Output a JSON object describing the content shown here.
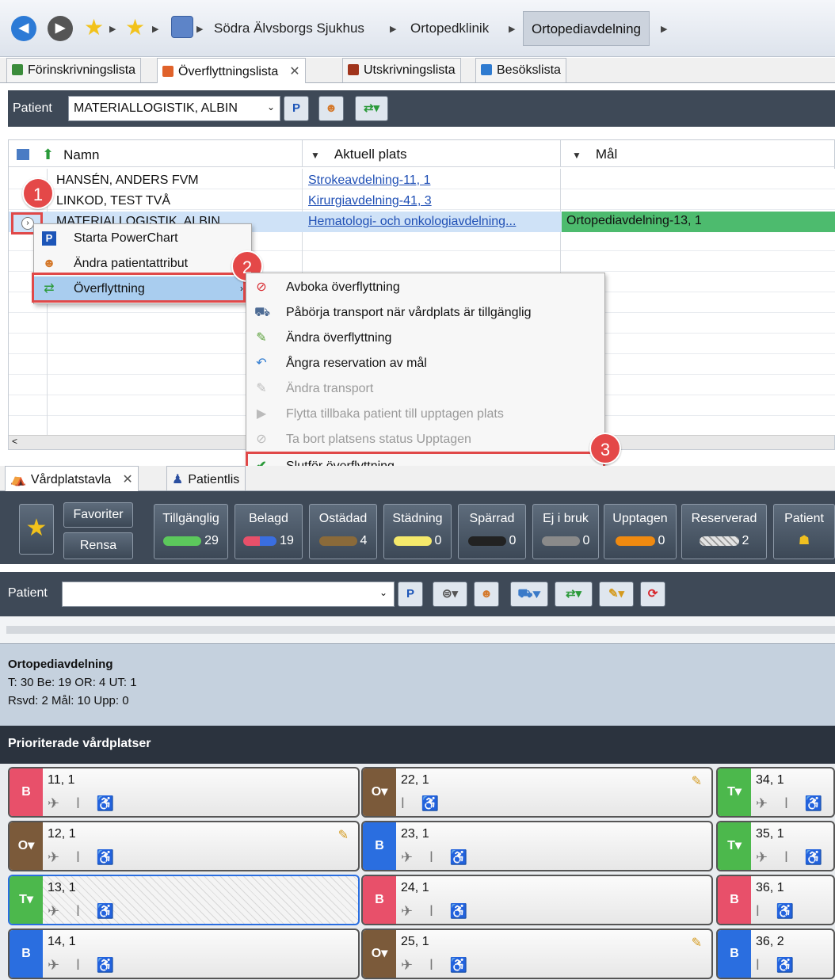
{
  "breadcrumb": {
    "items": [
      "Södra Älvsborgs Sjukhus",
      "Ortopedklinik",
      "Ortopediavdelning"
    ]
  },
  "top_tabs": [
    {
      "label": "Förinskrivningslista"
    },
    {
      "label": "Överflyttningslista"
    },
    {
      "label": "Utskrivningslista"
    },
    {
      "label": "Besökslista"
    }
  ],
  "patient_bar": {
    "label": "Patient",
    "selected": "MATERIALLOGISTIK, ALBIN",
    "p_button": "P"
  },
  "grid": {
    "columns": [
      "Namn",
      "Aktuell plats",
      "Mål"
    ],
    "rows": [
      {
        "name": "HANSÉN, ANDERS FVM",
        "place": "Strokeavdelning-11, 1",
        "goal": ""
      },
      {
        "name": "LINKOD, TEST TVÅ",
        "place": "Kirurgiavdelning-41, 3",
        "goal": ""
      },
      {
        "name": "MATERIALLOGISTIK, ALBIN",
        "place": "Hematologi- och onkologiavdelning...",
        "goal": "Ortopediavdelning-13, 1"
      }
    ]
  },
  "context_menu": [
    {
      "label": "Starta PowerChart",
      "icon": "p-icon"
    },
    {
      "label": "Ändra patientattribut",
      "icon": "person-icon"
    },
    {
      "label": "Överflyttning",
      "icon": "transfer-icon"
    }
  ],
  "submenu": [
    {
      "label": "Avboka överflyttning",
      "icon": "cancel-icon",
      "disabled": false
    },
    {
      "label": "Påbörja transport när vårdplats är tillgänglig",
      "icon": "ambulance-icon",
      "disabled": false
    },
    {
      "label": "Ändra överflyttning",
      "icon": "edit-icon",
      "disabled": false
    },
    {
      "label": "Ångra reservation av mål",
      "icon": "undo-icon",
      "disabled": false
    },
    {
      "label": "Ändra transport",
      "icon": "pencil-icon",
      "disabled": true
    },
    {
      "label": "Flytta tillbaka patient till upptagen plats",
      "icon": "play-icon",
      "disabled": true
    },
    {
      "label": "Ta bort platsens status Upptagen",
      "icon": "block-icon",
      "disabled": true
    },
    {
      "label": "Slutför överflyttning",
      "icon": "check-icon",
      "disabled": false
    }
  ],
  "badges": [
    "1",
    "2",
    "3"
  ],
  "bottom_tabs": [
    {
      "label": "Vårdplatstavla"
    },
    {
      "label": "Patientlis"
    }
  ],
  "board": {
    "favorites": "Favoriter",
    "clear": "Rensa",
    "stats": [
      {
        "label": "Tillgänglig",
        "count": "29",
        "color": "#5cc85c"
      },
      {
        "label": "Belagd",
        "count": "19",
        "color": "#e8506a"
      },
      {
        "label": "Ostädad",
        "count": "4",
        "color": "#8a6a3a"
      },
      {
        "label": "Städning",
        "count": "0",
        "color": "#f5e96b"
      },
      {
        "label": "Spärrad",
        "count": "0",
        "color": "#222222"
      },
      {
        "label": "Ej i bruk",
        "count": "0",
        "color": "#8a8a8a"
      },
      {
        "label": "Upptagen",
        "count": "0",
        "color": "#f08a10"
      },
      {
        "label": "Reserverad",
        "count": "2",
        "color": "#d0d0d0"
      },
      {
        "label": "Patient",
        "count": "",
        "color": ""
      }
    ]
  },
  "filter": {
    "label": "Patient",
    "value": "",
    "p_button": "P"
  },
  "ward": {
    "title": "Ortopediavdelning",
    "line1": "T: 30 Be: 19 OR: 4 UT: 1",
    "line2": "Rsvd: 2 Mål: 10 Upp: 0"
  },
  "priority_title": "Prioriterade vårdplatser",
  "slots": [
    {
      "id": "11, 1",
      "status": "B",
      "color": "#e8506a"
    },
    {
      "id": "22, 1",
      "status": "O▾",
      "color": "#7b5a3a"
    },
    {
      "id": "34, 1",
      "status": "T▾",
      "color": "#4cb84c"
    },
    {
      "id": "12, 1",
      "status": "O▾",
      "color": "#7b5a3a"
    },
    {
      "id": "23, 1",
      "status": "B",
      "color": "#2a6ee0"
    },
    {
      "id": "35, 1",
      "status": "T▾",
      "color": "#4cb84c"
    },
    {
      "id": "13, 1",
      "status": "T▾",
      "color": "#4cb84c"
    },
    {
      "id": "24, 1",
      "status": "B",
      "color": "#e8506a"
    },
    {
      "id": "36, 1",
      "status": "B",
      "color": "#e8506a"
    },
    {
      "id": "14, 1",
      "status": "B",
      "color": "#2a6ee0"
    },
    {
      "id": "25, 1",
      "status": "O▾",
      "color": "#7b5a3a"
    },
    {
      "id": "36, 2",
      "status": "B",
      "color": "#2a6ee0"
    }
  ]
}
